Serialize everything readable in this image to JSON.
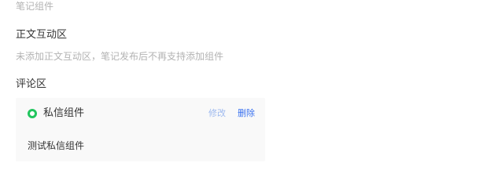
{
  "section": {
    "caption": "笔记组件"
  },
  "body_interaction": {
    "title": "正文互动区",
    "hint": "未添加正文互动区，笔记发布后不再支持添加组件"
  },
  "comment_area": {
    "title": "评论区",
    "component": {
      "name": "私信组件",
      "edit_label": "修改",
      "delete_label": "删除",
      "description": "测试私信组件",
      "status_icon": "green-ring-icon"
    }
  },
  "colors": {
    "status_green": "#22c55e",
    "link_blue": "#3b72f0",
    "link_blue_muted": "#9db9ef",
    "muted_text": "#b3b3b3",
    "card_bg": "#f9f9f9"
  }
}
